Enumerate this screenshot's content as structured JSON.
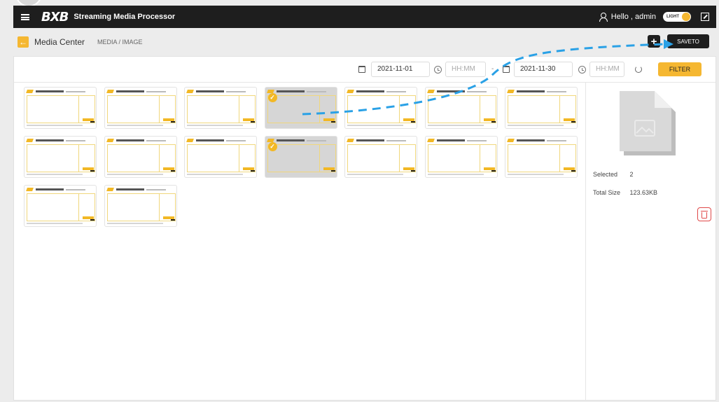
{
  "topbar": {
    "logo": "BXB",
    "app_title": "Streaming Media Processor",
    "greeting": "Hello , admin",
    "theme_label": "LIGHT"
  },
  "header": {
    "title": "Media Center",
    "breadcrumb": "MEDIA  /  IMAGE",
    "add_label": "+",
    "saveto_label": "SAVETO"
  },
  "filter": {
    "start_date": "2021-11-01",
    "start_time_placeholder": "HH:MM",
    "separator": "-",
    "end_date": "2021-11-30",
    "end_time_placeholder": "HH:MM",
    "filter_label": "FILTER"
  },
  "side": {
    "selected_label": "Selected",
    "selected_value": "2",
    "size_label": "Total Size",
    "size_value": "123.63KB"
  },
  "thumbnails": {
    "count": 16,
    "selected_indices": [
      3,
      10
    ]
  },
  "colors": {
    "accent": "#f5b731",
    "dark": "#1e1e1e",
    "annotation": "#2aa1e6",
    "danger": "#e04848"
  }
}
